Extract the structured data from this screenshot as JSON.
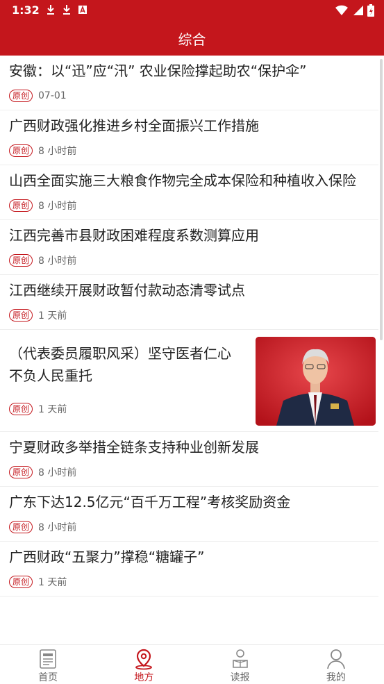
{
  "status": {
    "time": "1:32"
  },
  "appbar": {
    "title": "综合"
  },
  "articles": [
    {
      "title": "安徽：以“迅”应“汛” 农业保险撑起助农“保护伞”",
      "badge": "原创",
      "time": "07-01"
    },
    {
      "title": "广西财政强化推进乡村全面振兴工作措施",
      "badge": "原创",
      "time": "8 小时前"
    },
    {
      "title": "山西全面实施三大粮食作物完全成本保险和种植收入保险",
      "badge": "原创",
      "time": "8 小时前"
    },
    {
      "title": "江西完善市县财政困难程度系数测算应用",
      "badge": "原创",
      "time": "8 小时前"
    },
    {
      "title": "江西继续开展财政暂付款动态清零试点",
      "badge": "原创",
      "time": "1 天前"
    },
    {
      "title": "（代表委员履职风采）坚守医者仁心 不负人民重托",
      "badge": "原创",
      "time": "1 天前"
    },
    {
      "title": "宁夏财政多举措全链条支持种业创新发展",
      "badge": "原创",
      "time": "8 小时前"
    },
    {
      "title": "广东下达12.5亿元“百千万工程”考核奖励资金",
      "badge": "原创",
      "time": "8 小时前"
    },
    {
      "title": "广西财政“五聚力”撑稳“糖罐子”",
      "badge": "原创",
      "time": "1 天前"
    }
  ],
  "nav": [
    {
      "label": "首页",
      "icon": "newspaper-icon"
    },
    {
      "label": "地方",
      "icon": "location-pin-icon",
      "active": true
    },
    {
      "label": "读报",
      "icon": "reader-icon"
    },
    {
      "label": "我的",
      "icon": "user-icon"
    }
  ],
  "colors": {
    "brand": "#c4161c"
  }
}
